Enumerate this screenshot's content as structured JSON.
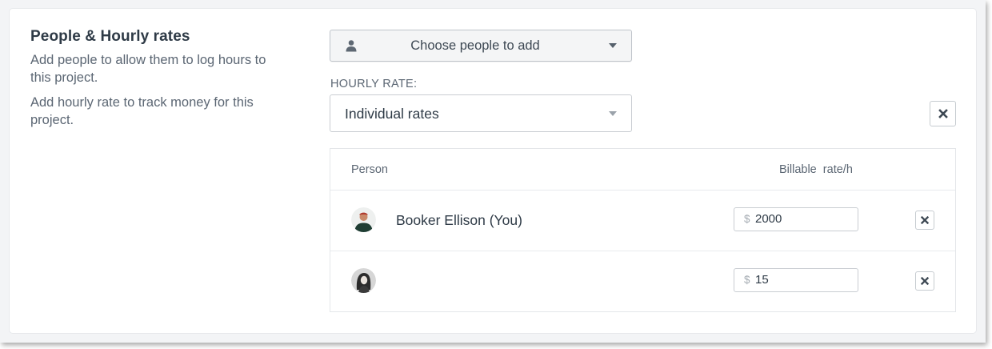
{
  "section": {
    "title": "People & Hourly rates",
    "desc_1": "Add people to allow them to log hours to this project.",
    "desc_2": "Add hourly rate to track money for this project."
  },
  "people_select": {
    "placeholder": "Choose people to add",
    "icon": "person-icon"
  },
  "hourly_rate": {
    "label": "HOURLY RATE:",
    "selected": "Individual rates"
  },
  "table": {
    "columns": {
      "person": "Person",
      "rate": "Billable  rate/h"
    },
    "rows": [
      {
        "name": "Booker Ellison (You)",
        "currency": "$",
        "rate": "2000",
        "avatar": "avatar-icon"
      },
      {
        "name": "",
        "currency": "$",
        "rate": "15",
        "avatar": "avatar-icon"
      }
    ]
  },
  "colors": {
    "text_primary": "#2e3a46",
    "text_secondary": "#5b6673",
    "border": "#c9cdd2"
  }
}
